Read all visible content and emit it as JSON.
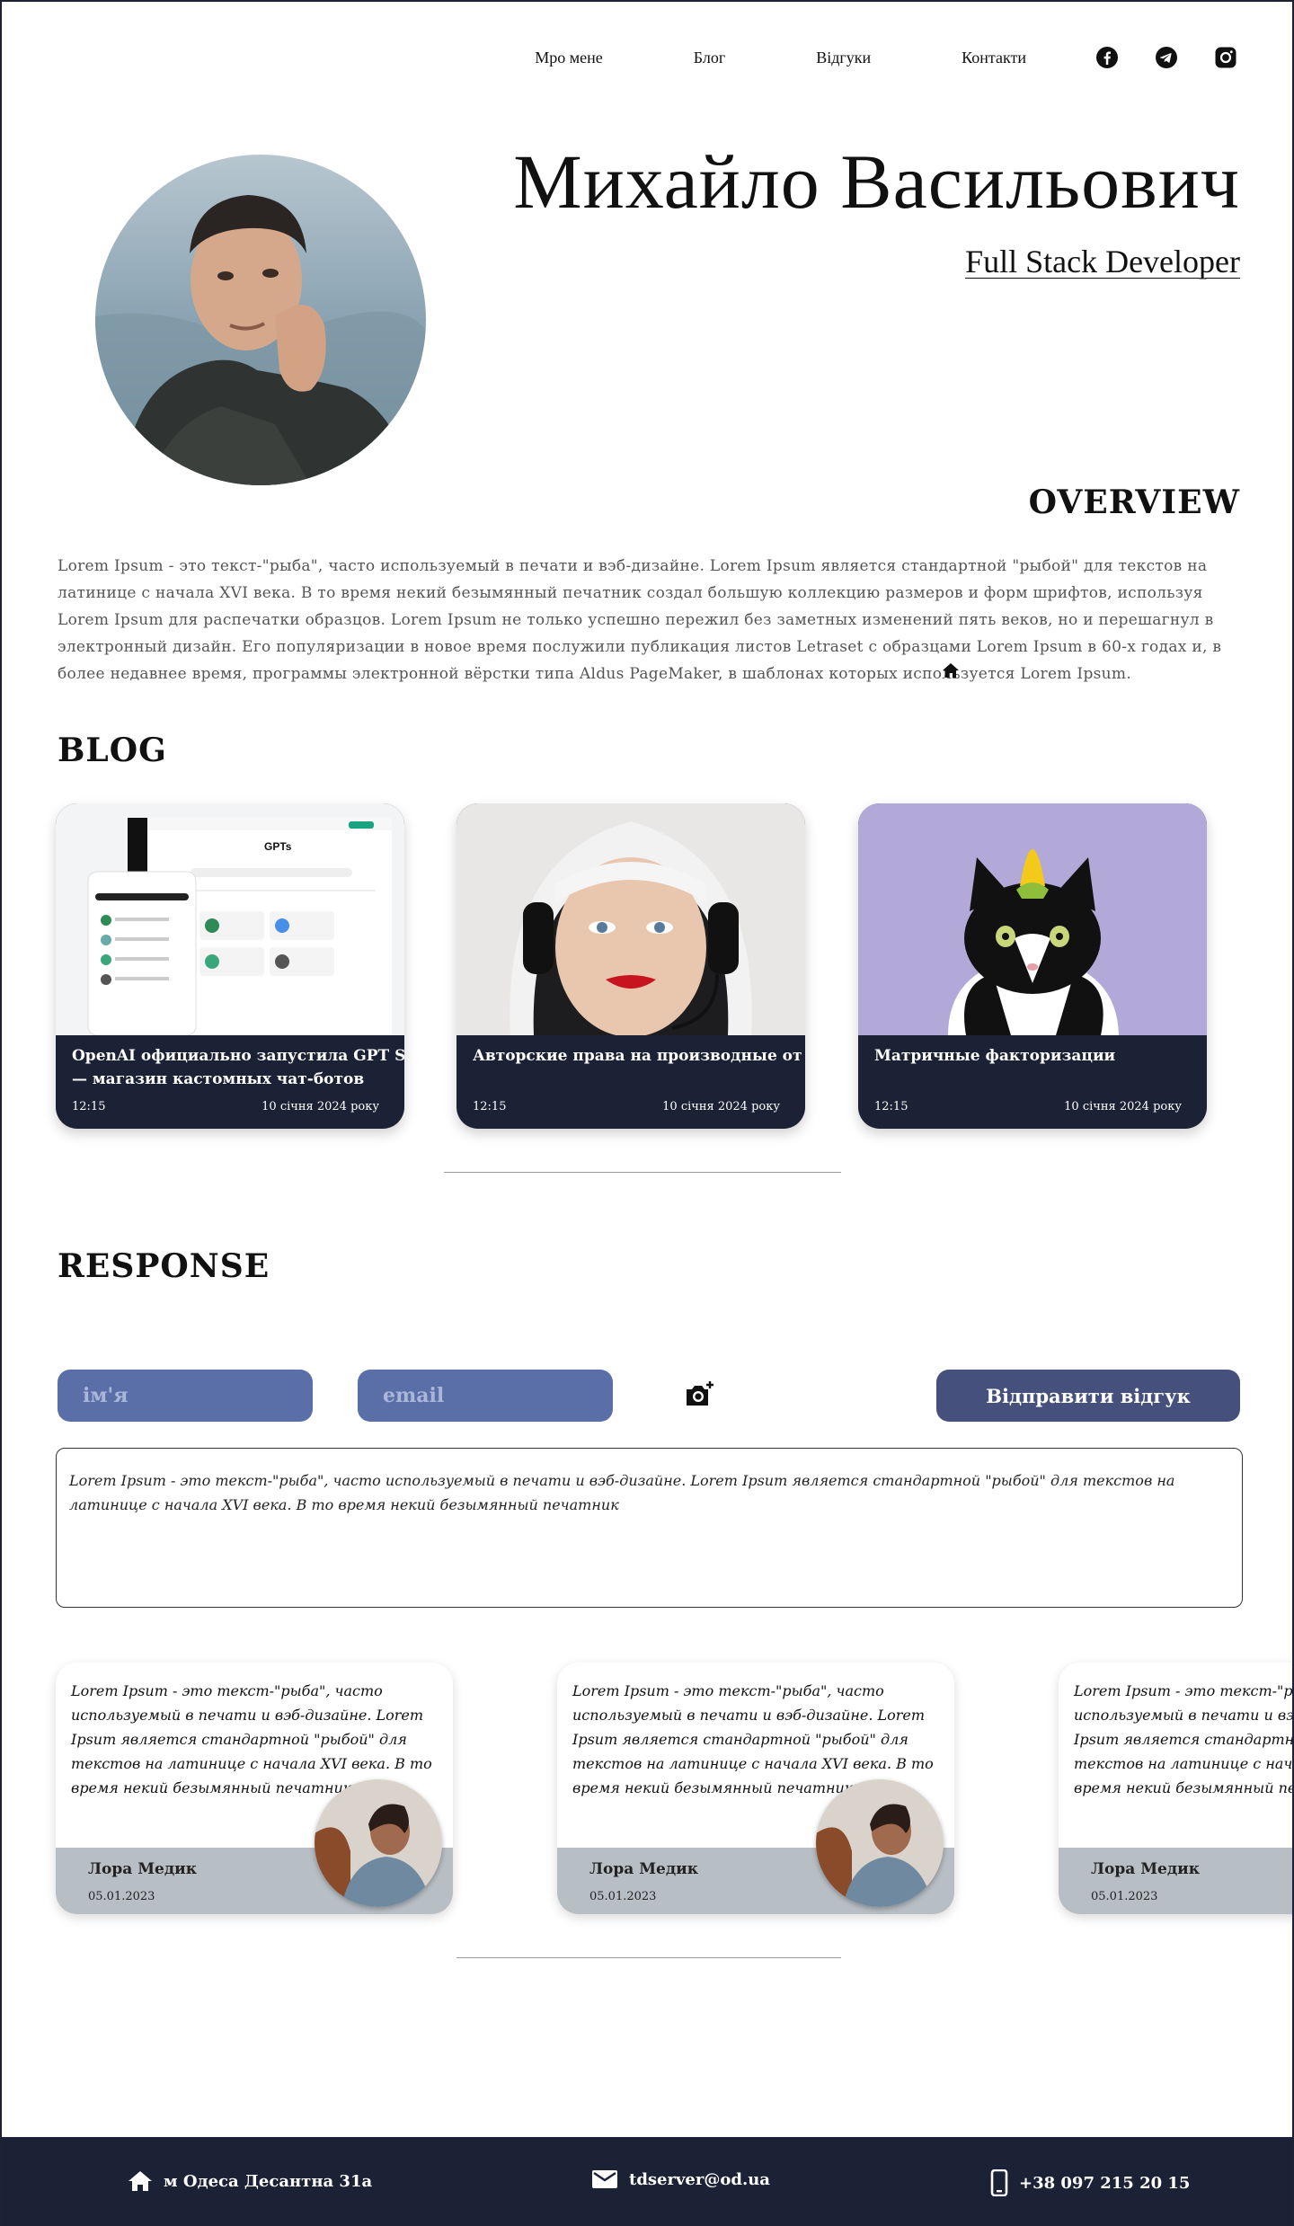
{
  "nav": {
    "items": [
      "Мро мене",
      "Блог",
      "Відгуки",
      "Контакти"
    ],
    "social": [
      "facebook-icon",
      "telegram-icon",
      "instagram-icon"
    ]
  },
  "hero": {
    "name": "Михайло Васильович",
    "role": "Full Stack Developer"
  },
  "overview": {
    "heading": "OVERVIEW",
    "text": "Lorem Ipsum - это текст-\"рыба\", часто используемый в печати и вэб-дизайне. Lorem Ipsum является стандартной \"рыбой\" для текстов на латинице с начала XVI века. В то время некий безымянный печатник создал большую коллекцию размеров и форм шрифтов, используя Lorem Ipsum для распечатки образцов. Lorem Ipsum не только успешно пережил без заметных изменений пять веков, но и перешагнул в электронный дизайн. Его популяризации в новое время послужили публикация листов Letraset с образцами Lorem Ipsum в 60-х годах и, в более недавнее время, программы электронной вёрстки типа Aldus PageMaker, в шаблонах которых используется Lorem Ipsum."
  },
  "blog": {
    "heading": "BLOG",
    "cards": [
      {
        "title_line1": "OpenAI официально запустила GPT Store",
        "title_line2": "— магазин кастомных чат-ботов",
        "time": "12:15",
        "date": "10 січня 2024 року",
        "image": "gpt-store-screenshot"
      },
      {
        "title_line1": "Авторские права на производные от ИИ",
        "title_line2": "",
        "time": "12:15",
        "date": "10 січня 2024 року",
        "image": "woman-headset-photo"
      },
      {
        "title_line1": "Матричные факторизации",
        "title_line2": "",
        "time": "12:15",
        "date": "10 січня 2024 року",
        "image": "cat-with-corn-photo"
      }
    ]
  },
  "response": {
    "heading": "RESPONSE",
    "name_placeholder": "ім'я",
    "email_placeholder": "email",
    "send_label": "Відправити відгук",
    "message": "Lorem Ipsum - это текст-\"рыба\", часто используемый в печати и вэб-дизайне. Lorem Ipsum является стандартной \"рыбой\" для текстов на латинице с начала XVI века. В то время некий безымянный печатник"
  },
  "reviews": [
    {
      "text": "Lorem Ipsum - это текст-\"рыба\", часто используемый в печати и вэб-дизайне. Lorem Ipsum является стандартной \"рыбой\" для текстов на латинице с начала XVI века. В то время некий безымянный печатник",
      "name": "Лора Медик",
      "date": "05.01.2023"
    },
    {
      "text": "Lorem Ipsum - это текст-\"рыба\", часто используемый в печати и вэб-дизайне. Lorem Ipsum является стандартной \"рыбой\" для текстов на латинице с начала XVI века. В то время некий безымянный печатник",
      "name": "Лора Медик",
      "date": "05.01.2023"
    },
    {
      "text": "Lorem Ipsum - это текст-\"рыба\", часто используемый в печати и вэб-дизайне. Lorem Ipsum является стандартной \"рыбой\" для текстов на латинице с начала XVI века. В то время некий безымянный печатник",
      "name": "Лора Медик",
      "date": "05.01.2023"
    }
  ],
  "footer": {
    "address": "м Одеса Десантна 31а",
    "email": "tdserver@od.ua",
    "phone": "+38 097 215 20 15"
  },
  "colors": {
    "dark_navy": "#1c2236",
    "input_blue": "#5a6fa8",
    "button_blue": "#46507c",
    "review_bar": "#b7bec4"
  }
}
